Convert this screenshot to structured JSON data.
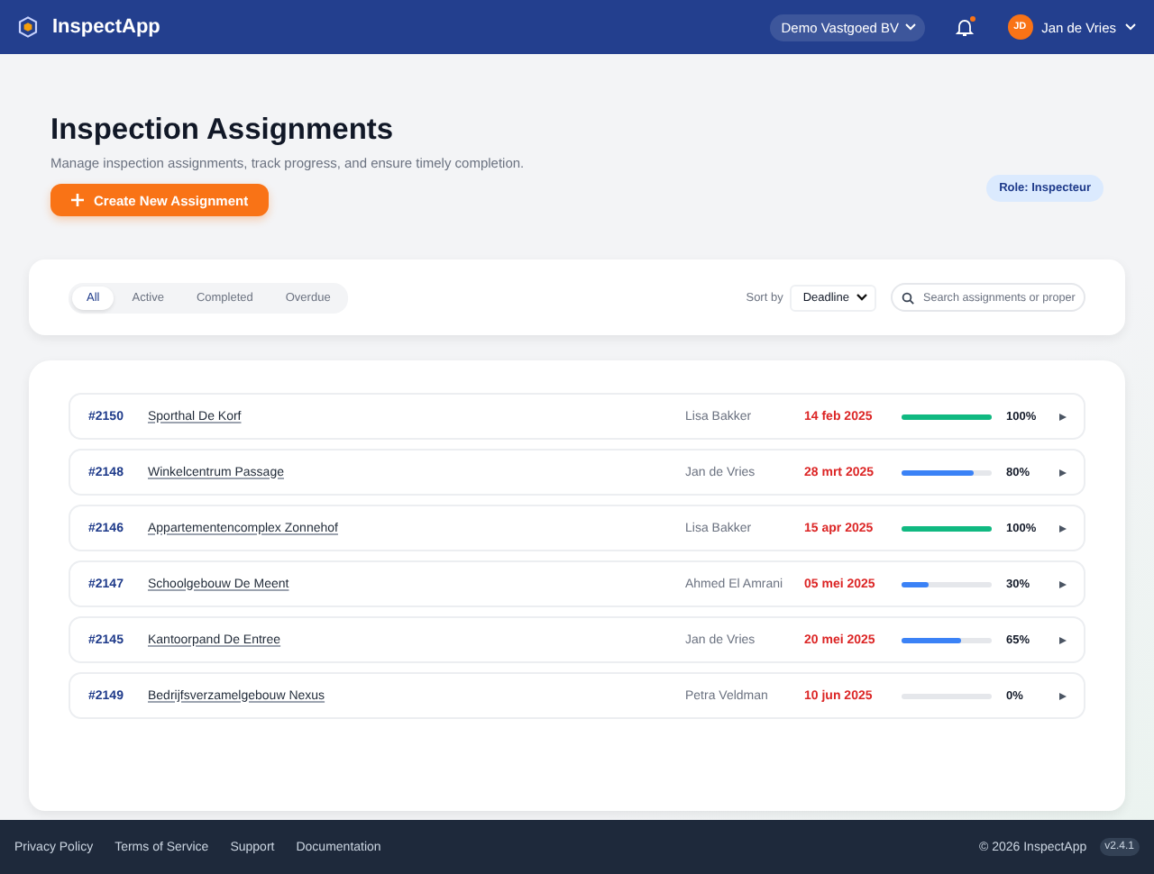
{
  "header": {
    "app_name": "InspectApp",
    "organization": "Demo Vastgoed BV",
    "notifications": {
      "unread": true
    },
    "user": {
      "initials": "JD",
      "name": "Jan de Vries"
    }
  },
  "page": {
    "title": "Inspection Assignments",
    "subtitle": "Manage inspection assignments, track progress, and ensure timely completion.",
    "create_button": "Create New Assignment",
    "role_badge": "Role: Inspecteur"
  },
  "filters": {
    "tabs": [
      {
        "label": "All",
        "selected": true
      },
      {
        "label": "Active",
        "selected": false
      },
      {
        "label": "Completed",
        "selected": false
      },
      {
        "label": "Overdue",
        "selected": false
      }
    ],
    "sort_label": "Sort by",
    "sort_value": "Deadline",
    "search": {
      "placeholder": "Search assignments or proper"
    }
  },
  "assignments": [
    {
      "id": "#2150",
      "property": "Sporthal De Korf",
      "inspector": "Lisa Bakker",
      "deadline": "14 feb 2025",
      "level": 1,
      "percent": "100%"
    },
    {
      "id": "#2148",
      "property": "Winkelcentrum Passage",
      "inspector": "Jan de Vries",
      "deadline": "28 mrt 2025",
      "level": 0.8,
      "percent": "80%"
    },
    {
      "id": "#2146",
      "property": "Appartementencomplex Zonnehof",
      "inspector": "Lisa Bakker",
      "deadline": "15 apr 2025",
      "level": 1,
      "percent": "100%"
    },
    {
      "id": "#2147",
      "property": "Schoolgebouw De Meent",
      "inspector": "Ahmed El Amrani",
      "deadline": "05 mei 2025",
      "level": 0.3,
      "percent": "30%"
    },
    {
      "id": "#2145",
      "property": "Kantoorpand De Entree",
      "inspector": "Jan de Vries",
      "deadline": "20 mei 2025",
      "level": 0.65,
      "percent": "65%"
    },
    {
      "id": "#2149",
      "property": "Bedrijfsverzamelgebouw Nexus",
      "inspector": "Petra Veldman",
      "deadline": "10 jun 2025",
      "percent": "0%"
    }
  ],
  "footer": {
    "links": [
      "Privacy Policy",
      "Terms of Service",
      "Support",
      "Documentation"
    ],
    "copyright": "© 2026 InspectApp",
    "version": "v2.4.1"
  }
}
